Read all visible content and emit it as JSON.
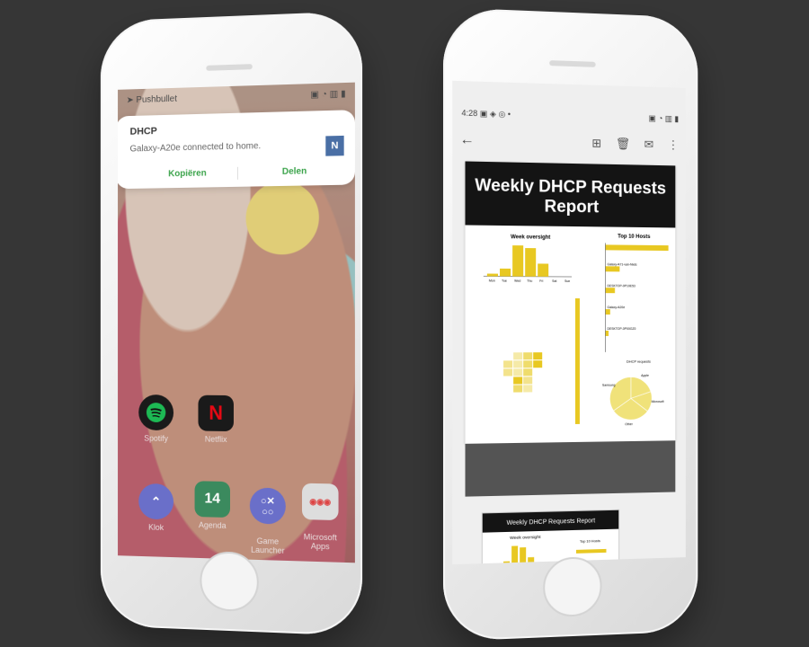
{
  "left_phone": {
    "statusbar": {
      "app_name": "Pushbullet"
    },
    "notification": {
      "title": "DHCP",
      "body": "Galaxy-A20e connected to home.",
      "avatar_letter": "N",
      "action_copy": "Kopiëren",
      "action_share": "Delen",
      "accent_color": "#3aa34a"
    },
    "apps": [
      {
        "label": "Spotify",
        "icon": "spotify-icon",
        "color": "#1db954"
      },
      {
        "label": "Netflix",
        "icon": "netflix-icon",
        "color": "#e50914"
      },
      {
        "label": "Klok",
        "icon": "clock-icon",
        "color": "#6a6fc9"
      },
      {
        "label": "Agenda",
        "icon": "calendar-icon",
        "color": "#3b8a5e"
      },
      {
        "label": "Game\nLauncher",
        "icon": "game-launcher-icon",
        "color": "#6a6fc9"
      },
      {
        "label": "Microsoft\nApps",
        "icon": "microsoft-apps-icon",
        "color": "#cccccc"
      }
    ],
    "calendar_day": "14"
  },
  "right_phone": {
    "statusbar": {
      "time": "4:28"
    },
    "report": {
      "title": "Weekly DHCP Requests Report",
      "chart_week_title": "Week oversight",
      "chart_hosts_title": "Top 10 Hosts",
      "hosts_xlabel": "DHCP requests",
      "thumb_title": "Weekly DHCP Requests Report",
      "thumb_week_title": "Week oversight",
      "thumb_hosts_title": "Top 10 Hosts"
    }
  },
  "chart_data": [
    {
      "type": "bar",
      "title": "Week oversight",
      "categories": [
        "Mon",
        "Tue",
        "Wed",
        "Thu",
        "Fri",
        "Sat",
        "Sun"
      ],
      "values": [
        1,
        3,
        12,
        11,
        5,
        0,
        0
      ],
      "ylim": [
        0,
        14
      ],
      "color": "#e8c822"
    },
    {
      "type": "bar",
      "title": "Top 10 Hosts",
      "orientation": "horizontal",
      "categories": [
        "",
        "Galaxy-A71-van-Niels",
        "DESKTOP-0P10E53",
        "Galaxy-A20e",
        "DESKTOP-0P00GZ0"
      ],
      "values": [
        80,
        18,
        12,
        6,
        4
      ],
      "xlabel": "DHCP requests",
      "color": "#e8c822"
    },
    {
      "type": "pie",
      "labels": [
        "Apple",
        "Microsoft",
        "Other",
        "Samsung"
      ],
      "values": [
        20,
        15.4,
        30,
        34.6
      ],
      "color": "#f0e27a"
    }
  ]
}
